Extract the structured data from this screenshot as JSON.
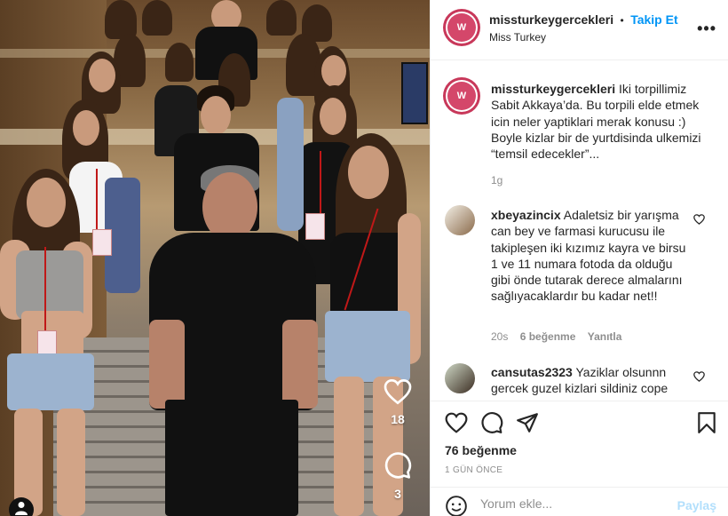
{
  "post": {
    "username": "missturkeygercekleri",
    "follow_label": "Takip Et",
    "separator": "•",
    "subtitle": "Miss Turkey",
    "avatar_text": "W",
    "caption": "Iki torpillimiz Sabit Akkaya’da. Bu torpili elde etmek icin neler yaptiklari merak konusu :) Boyle kizlar bir de yurtdisinda ulkemizi “temsil edecekler”...",
    "caption_time": "1g"
  },
  "media": {
    "like_count": "18",
    "comment_count": "3"
  },
  "comments": [
    {
      "username": "xbeyazincix",
      "text": "Adaletsiz bir yarışma can bey ve farmasi kurucusu ile takipleşen iki kızımız kayra ve birsu 1 ve 11 numara fotoda da olduğu gibi önde tutarak derece almalarını sağlıyacaklardır bu kadar net!!",
      "time": "20s",
      "likes": "6 beğenme",
      "reply": "Yanıtla"
    },
    {
      "username": "cansutas2323",
      "text": "Yaziklar olsunnn gercek guzel kizlari sildiniz cope"
    }
  ],
  "footer": {
    "likes": "76 beğenme",
    "time_ago": "1 GÜN ÖNCE",
    "comment_placeholder": "Yorum ekle...",
    "post_label": "Paylaş"
  },
  "colors": {
    "link_blue": "#0095f6",
    "post_disabled": "#b2dffc",
    "brand_ring": "#c8385a"
  }
}
